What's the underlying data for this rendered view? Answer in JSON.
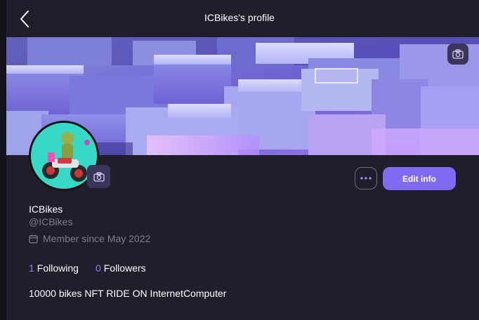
{
  "header": {
    "title": "ICBikes's profile",
    "back_icon": "chevron-left-icon"
  },
  "banner": {
    "camera_icon": "camera-icon"
  },
  "avatar": {
    "camera_icon": "camera-icon"
  },
  "actions": {
    "more_icon": "more-dots-icon",
    "edit_label": "Edit info"
  },
  "profile": {
    "display_name": "ICBikes",
    "handle": "@ICBikes",
    "member_since": "Member since May 2022",
    "following_count": "1",
    "following_label": "Following",
    "followers_count": "0",
    "followers_label": "Followers",
    "bio": "10000 bikes NFT RIDE ON InternetComputer"
  },
  "colors": {
    "background": "#201e2b",
    "accent": "#7f6af2",
    "muted_text": "#7f7b91",
    "stat_number": "#8f82f5"
  }
}
